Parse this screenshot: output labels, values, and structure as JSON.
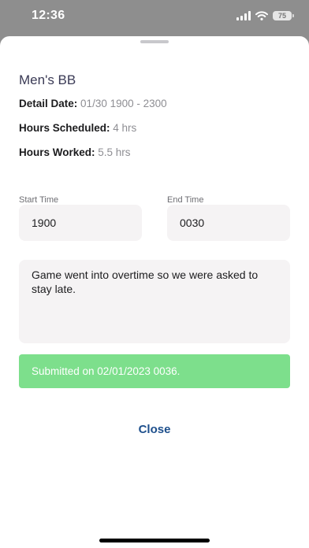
{
  "status_bar": {
    "time": "12:36",
    "battery_level": "75",
    "icons": [
      "signal-icon",
      "wifi-icon",
      "battery-icon"
    ]
  },
  "detail": {
    "title": "Men's BB",
    "detail_date_label": "Detail Date:",
    "detail_date_value": "01/30 1900 - 2300",
    "hours_scheduled_label": "Hours Scheduled:",
    "hours_scheduled_value": "4 hrs",
    "hours_worked_label": "Hours Worked:",
    "hours_worked_value": "5.5 hrs"
  },
  "times": {
    "start_label": "Start Time",
    "start_value": "1900",
    "end_label": "End Time",
    "end_value": "0030"
  },
  "notes": {
    "value": "Game went into overtime so we were asked to stay late."
  },
  "submission": {
    "message": "Submitted on 02/01/2023 0036.",
    "color": "#7ddf8c"
  },
  "actions": {
    "close_label": "Close",
    "close_color": "#1d4f8c"
  }
}
